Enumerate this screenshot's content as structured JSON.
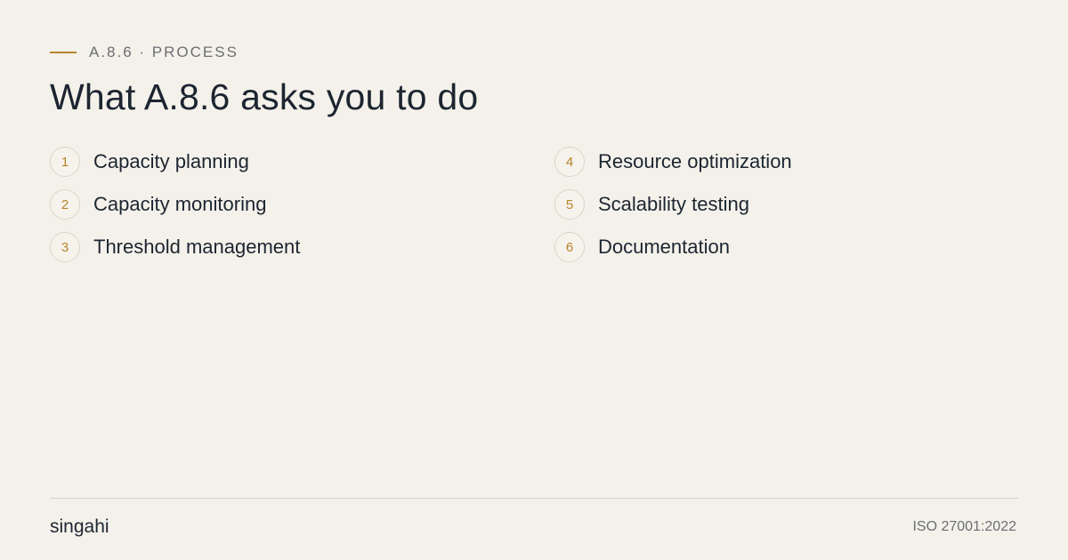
{
  "header": {
    "eyebrow": "A.8.6 · PROCESS",
    "title": "What A.8.6 asks you to do"
  },
  "items": [
    {
      "number": "1",
      "label": "Capacity planning"
    },
    {
      "number": "4",
      "label": "Resource optimization"
    },
    {
      "number": "2",
      "label": "Capacity monitoring"
    },
    {
      "number": "5",
      "label": "Scalability testing"
    },
    {
      "number": "3",
      "label": "Threshold management"
    },
    {
      "number": "6",
      "label": "Documentation"
    }
  ],
  "footer": {
    "brand": "singahi",
    "standard": "ISO 27001:2022"
  },
  "colors": {
    "background": "#f4f1eb",
    "accent": "#b7842b",
    "text": "#1c2530",
    "muted": "#6b6f72"
  }
}
